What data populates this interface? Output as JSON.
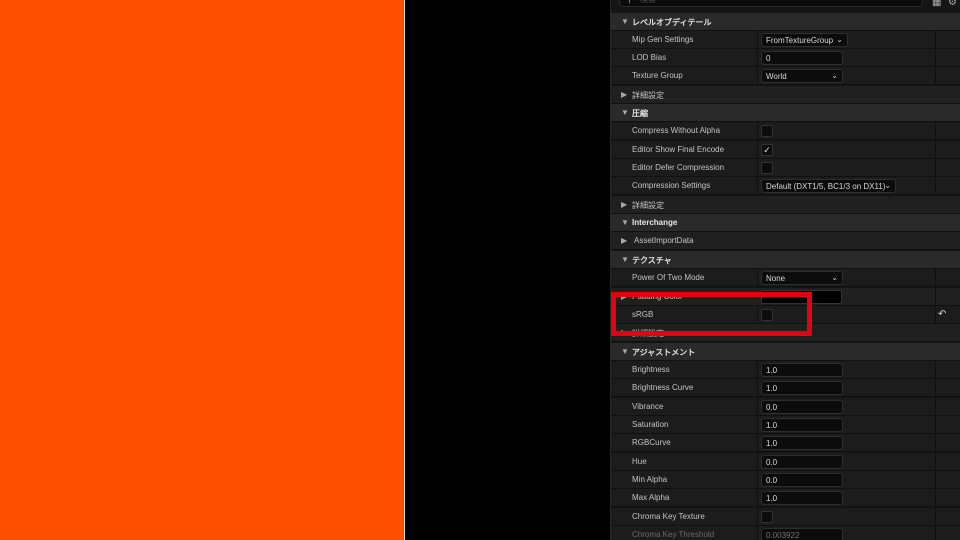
{
  "viewport": {
    "left_color": "#ff5000",
    "right_color": "#000000"
  },
  "search": {
    "placeholder": "検索",
    "icon": "search-icon"
  },
  "toolbar_icons": [
    "grid-icon",
    "settings-icon"
  ],
  "highlight_color": "#e60012",
  "rows": {
    "level_of_detail": "レベルオブディテール",
    "mip_gen_settings": {
      "label": "Mip Gen Settings",
      "value": "FromTextureGroup"
    },
    "lod_bias": {
      "label": "LOD Bias",
      "value": "0"
    },
    "texture_group": {
      "label": "Texture Group",
      "value": "World"
    },
    "advanced_1": "詳細設定",
    "compression": "圧縮",
    "compress_without_alpha": {
      "label": "Compress Without Alpha",
      "checked": false
    },
    "editor_show_final_encode": {
      "label": "Editor Show Final Encode",
      "checked": true
    },
    "editor_defer_compression": {
      "label": "Editor Defer Compression",
      "checked": false
    },
    "compression_settings": {
      "label": "Compression Settings",
      "value": "Default (DXT1/5, BC1/3 on DX11)"
    },
    "advanced_2": "詳細設定",
    "interchange": "Interchange",
    "asset_import_data": "AssetImportData",
    "texture": "テクスチャ",
    "power_of_two_mode": {
      "label": "Power Of Two Mode",
      "value": "None"
    },
    "padding_color": {
      "label": "Padding Color",
      "color": "#000000"
    },
    "srgb": {
      "label": "sRGB",
      "checked": false
    },
    "advanced_3": "詳細設定",
    "adjustments": "アジャストメント",
    "brightness": {
      "label": "Brightness",
      "value": "1.0"
    },
    "brightness_curve": {
      "label": "Brightness Curve",
      "value": "1.0"
    },
    "vibrance": {
      "label": "Vibrance",
      "value": "0.0"
    },
    "saturation": {
      "label": "Saturation",
      "value": "1.0"
    },
    "rgb_curve": {
      "label": "RGBCurve",
      "value": "1.0"
    },
    "hue": {
      "label": "Hue",
      "value": "0.0"
    },
    "min_alpha": {
      "label": "Min Alpha",
      "value": "0.0"
    },
    "max_alpha": {
      "label": "Max Alpha",
      "value": "1.0"
    },
    "chroma_key_texture": {
      "label": "Chroma Key Texture",
      "checked": false
    },
    "chroma_key_threshold": {
      "label": "Chroma Key Threshold",
      "value": "0.003922"
    }
  }
}
